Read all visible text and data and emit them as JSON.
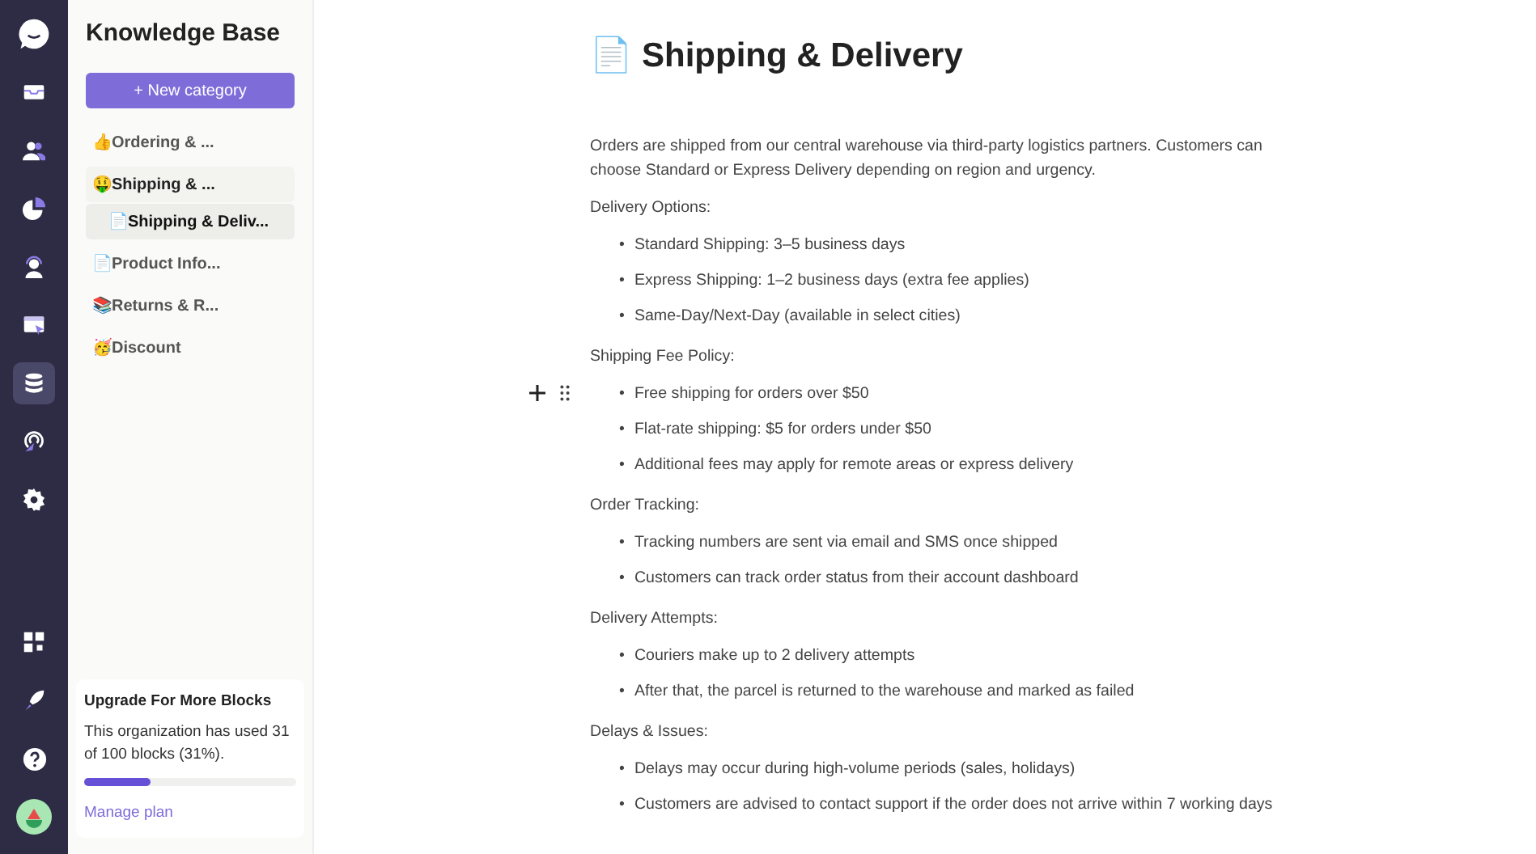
{
  "nav_rail": {
    "items": [
      {
        "kind": "inbox",
        "selected": false
      },
      {
        "kind": "contacts",
        "selected": false
      },
      {
        "kind": "reports",
        "selected": false
      },
      {
        "kind": "agent",
        "selected": false
      },
      {
        "kind": "campaign",
        "selected": false
      },
      {
        "kind": "knowledge",
        "selected": true
      },
      {
        "kind": "signal",
        "selected": false
      },
      {
        "kind": "settings",
        "selected": false
      }
    ],
    "bottom_items": [
      {
        "kind": "apps"
      },
      {
        "kind": "launch"
      },
      {
        "kind": "help"
      },
      {
        "kind": "avatar"
      }
    ]
  },
  "sidebar": {
    "title": "Knowledge Base",
    "new_button": "+ New category",
    "items": [
      {
        "label": "👍Ordering & ...",
        "selected": false,
        "expanded": false
      },
      {
        "label": "🤑Shipping & ...",
        "selected": false,
        "expanded": true,
        "children": [
          {
            "label": "📄Shipping & Deliv...",
            "selected": true
          }
        ]
      },
      {
        "label": "📄Product Info...",
        "selected": false,
        "expanded": false
      },
      {
        "label": "📚Returns & R...",
        "selected": false,
        "expanded": false
      },
      {
        "label": "🥳Discount",
        "selected": false,
        "expanded": false
      }
    ],
    "upgrade": {
      "title": "Upgrade For More Blocks",
      "text": "This organization has used 31 of 100 blocks (31%).",
      "level": 0.31,
      "link": "Manage plan"
    }
  },
  "article": {
    "emoji": "📄",
    "title": "Shipping & Delivery",
    "blocks": [
      {
        "kind": "paragraph",
        "text": "Orders are shipped from our central warehouse via third-party logistics partners. Customers can choose Standard or Express Delivery depending on region and urgency."
      },
      {
        "kind": "paragraph",
        "text": "Delivery Options:"
      },
      {
        "kind": "list",
        "marker": "•",
        "items": [
          "Standard Shipping: 3–5 business days",
          "Express Shipping: 1–2 business days (extra fee applies)",
          "Same-Day/Next-Day (available in select cities)"
        ]
      },
      {
        "kind": "paragraph",
        "text": "Shipping Fee Policy:"
      },
      {
        "kind": "list",
        "marker": "•",
        "hovered": true,
        "items": [
          "Free shipping for orders over $50",
          "Flat-rate shipping: $5 for orders under $50",
          "Additional fees may apply for remote areas or express delivery"
        ]
      },
      {
        "kind": "paragraph",
        "text": "Order Tracking:"
      },
      {
        "kind": "list",
        "marker": "•",
        "items": [
          "Tracking numbers are sent via email and SMS once shipped",
          "Customers can track order status from their account dashboard"
        ]
      },
      {
        "kind": "paragraph",
        "text": "Delivery Attempts:"
      },
      {
        "kind": "list",
        "marker": "•",
        "items": [
          "Couriers make up to 2 delivery attempts",
          "After that, the parcel is returned to the warehouse and marked as failed"
        ]
      },
      {
        "kind": "paragraph",
        "text": "Delays & Issues:"
      },
      {
        "kind": "list",
        "marker": "•",
        "items": [
          "Delays may occur during high-volume periods (sales, holidays)",
          "Customers are advised to contact support if the order does not arrive within 7 working days"
        ]
      }
    ]
  }
}
